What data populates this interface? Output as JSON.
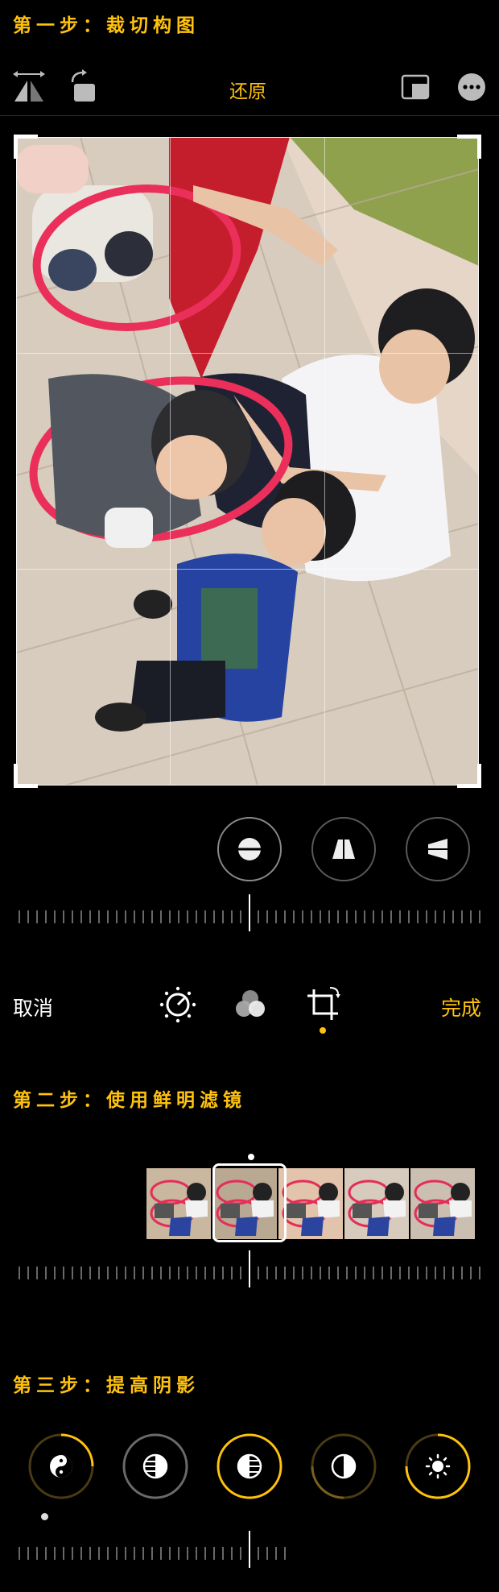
{
  "steps": {
    "step1": "第一步：裁切构图",
    "step2": "第二步：使用鲜明滤镜",
    "step3": "第三步：提高阴影"
  },
  "toolbar": {
    "reset_label": "还原",
    "icons": [
      "flip-icon",
      "rotate-icon",
      "aspect-ratio-icon",
      "more-icon"
    ]
  },
  "straighten_tools": [
    "straighten-icon",
    "vertical-perspective-icon",
    "horizontal-perspective-icon"
  ],
  "bottom_bar": {
    "cancel_label": "取消",
    "done_label": "完成",
    "modes": [
      "adjust-icon",
      "filters-icon",
      "crop-icon"
    ],
    "active_mode": "crop-icon"
  },
  "adjust_tools": [
    "exposure-icon",
    "brilliance-icon",
    "highlights-icon",
    "shadows-icon",
    "brightness-icon"
  ],
  "adjust_active": "highlights-icon",
  "colors": {
    "accent": "#ffc20e",
    "background": "#000000",
    "grid": "#ffffff"
  }
}
